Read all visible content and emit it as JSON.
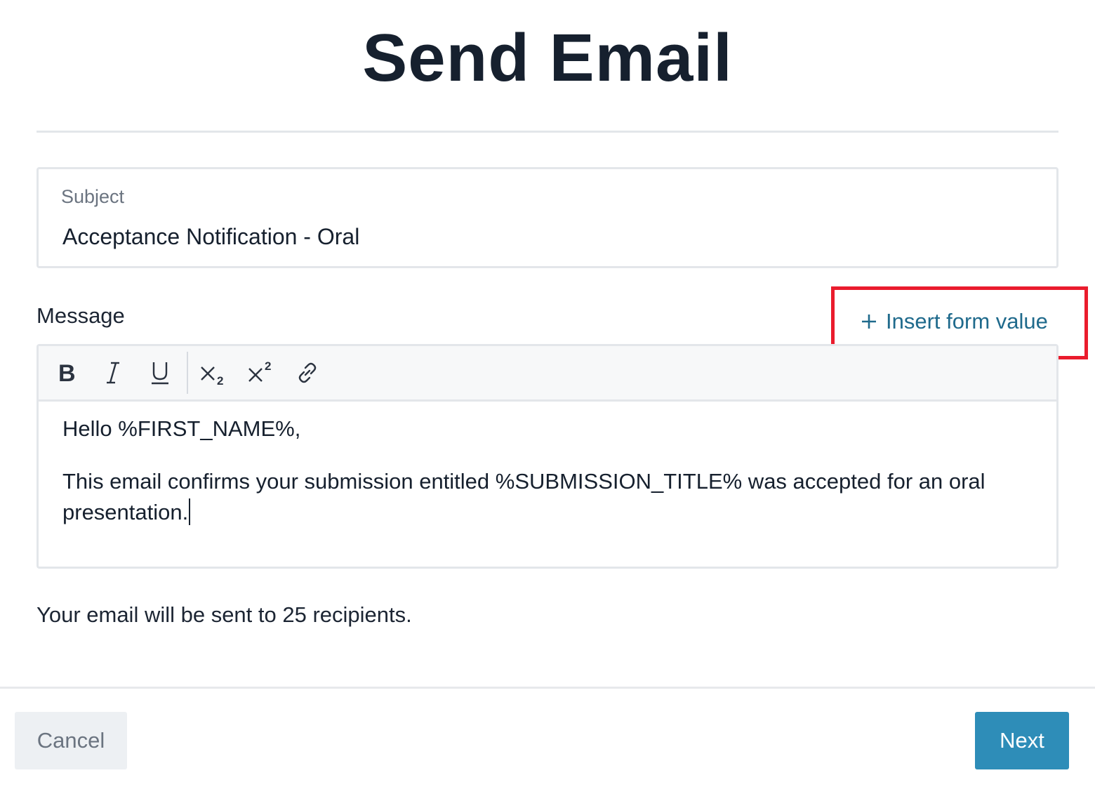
{
  "header": {
    "title": "Send Email"
  },
  "subject": {
    "label": "Subject",
    "value": "Acceptance Notification - Oral"
  },
  "message": {
    "label": "Message",
    "insert_form_value": "Insert form value",
    "insert_icon": "plus-icon",
    "toolbar": {
      "tools": [
        "bold-icon",
        "italic-icon",
        "underline-icon",
        "subscript-icon",
        "superscript-icon",
        "link-icon"
      ]
    },
    "body": {
      "line1": "Hello %FIRST_NAME%,",
      "line2": "This email confirms your submission entitled %SUBMISSION_TITLE% was accepted for an oral presentation."
    }
  },
  "recipients_text": "Your email will be sent to 25 recipients.",
  "footer": {
    "cancel_label": "Cancel",
    "next_label": "Next"
  },
  "colors": {
    "accent": "#2e8db8",
    "link": "#1f6a8c",
    "highlight": "#ea1c2d"
  }
}
